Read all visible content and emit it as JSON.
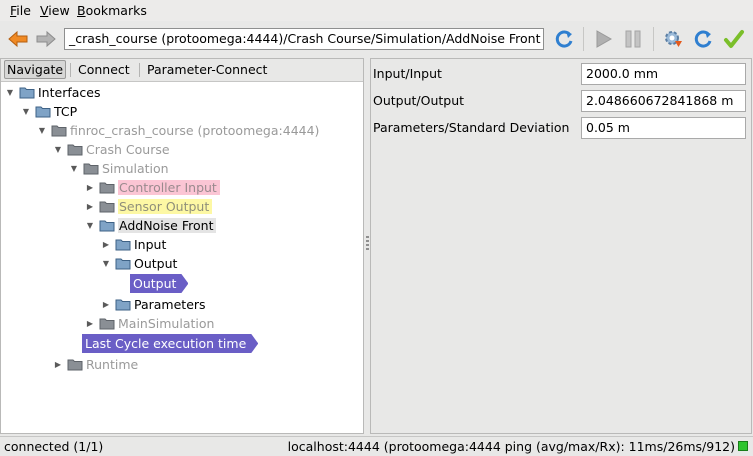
{
  "menu": {
    "file": {
      "accel": "F",
      "rest": "ile"
    },
    "view": {
      "accel": "V",
      "rest": "iew"
    },
    "bookmarks": {
      "accel": "B",
      "rest": "ookmarks"
    }
  },
  "toolbar": {
    "address": "_crash_course (protoomega:4444)/Crash Course/Simulation/AddNoise Front",
    "icons": {
      "back": "arrow-left-icon",
      "forward": "arrow-right-icon",
      "refresh": "refresh-icon",
      "play": "play-icon",
      "pause": "pause-icon",
      "connect": "connect-icon",
      "reload": "reload-icon",
      "apply": "checkmark-icon"
    }
  },
  "tabs": [
    "Navigate",
    "Connect",
    "Parameter-Connect"
  ],
  "tree": {
    "interfaces": "Interfaces",
    "tcp": "TCP",
    "crash_course_root": "finroc_crash_course (protoomega:4444)",
    "crash_course": "Crash Course",
    "simulation": "Simulation",
    "controller_input": "Controller Input",
    "sensor_output": "Sensor Output",
    "addnoise_front": "AddNoise Front",
    "input": "Input",
    "output": "Output",
    "output_port": "Output",
    "parameters": "Parameters",
    "main_simulation": "MainSimulation",
    "last_cycle": "Last Cycle execution time",
    "runtime": "Runtime"
  },
  "properties": [
    {
      "label": "Input/Input",
      "value": "2000.0 mm"
    },
    {
      "label": "Output/Output",
      "value": "2.048660672841868 m"
    },
    {
      "label": "Parameters/Standard Deviation",
      "value": "0.05 m"
    }
  ],
  "status": {
    "left": "connected (1/1)",
    "right": "localhost:4444 (protoomega:4444 ping (avg/max/Rx): 11ms/26ms/912)"
  },
  "colors": {
    "port": "#6a5ec6",
    "pink_highlight": "#fbc5d4",
    "yellow_highlight": "#fdf8a4",
    "status_ok": "#2fc42f"
  }
}
